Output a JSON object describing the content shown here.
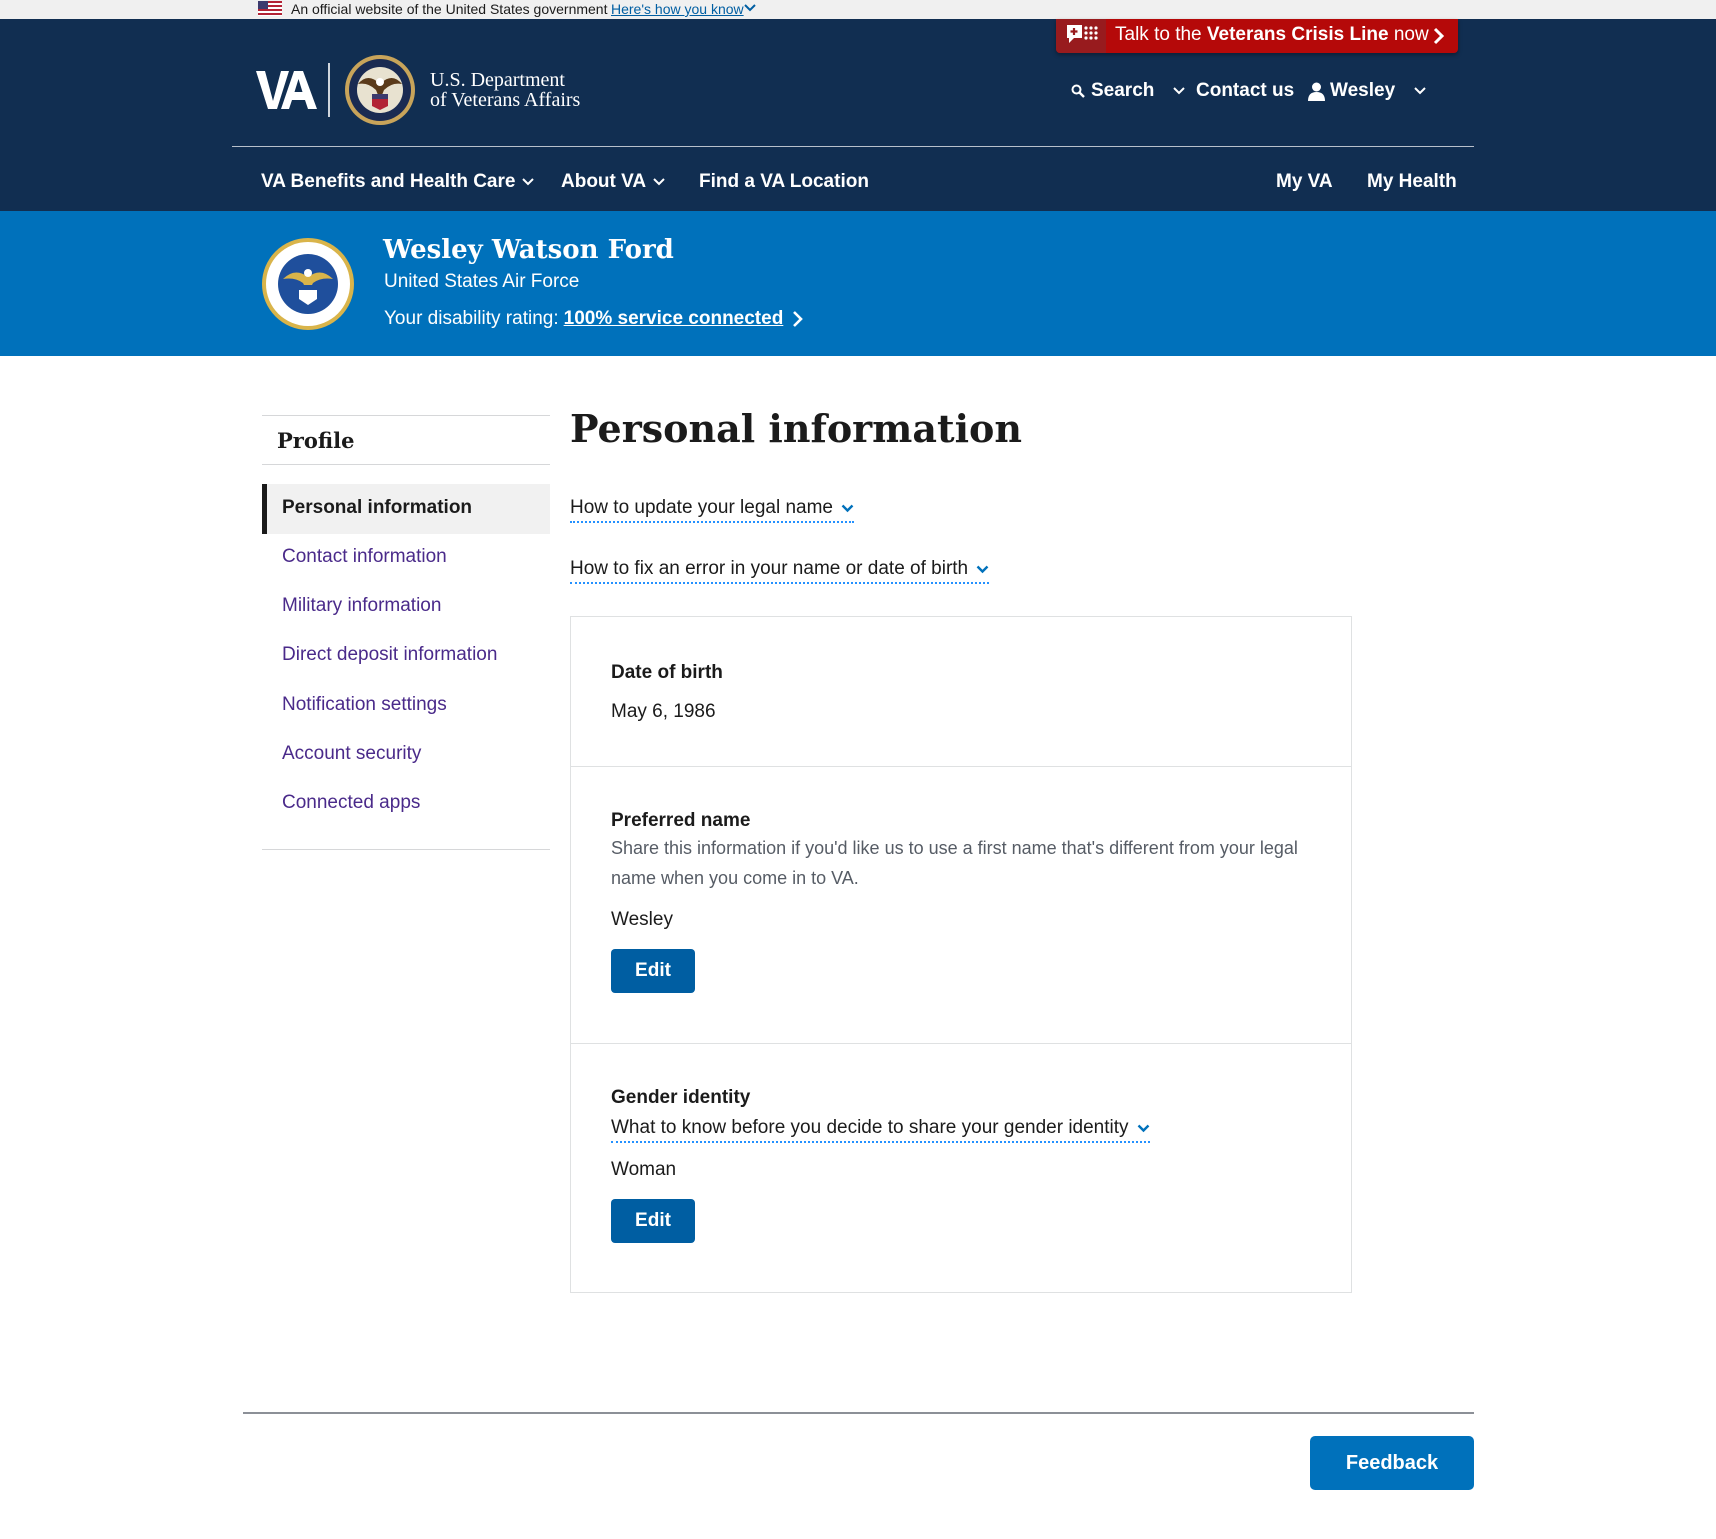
{
  "gov_banner": {
    "text": "An official website of the United States government",
    "link": "Here's how you know"
  },
  "crisis_line": {
    "prefix": "Talk to the ",
    "bold": "Veterans Crisis Line",
    "suffix": " now"
  },
  "header": {
    "dept_line1": "U.S. Department",
    "dept_line2": "of Veterans Affairs",
    "logo_text": "VA",
    "search_label": "Search",
    "contact_label": "Contact us",
    "user_label": "Wesley"
  },
  "nav": {
    "benefits": "VA Benefits and Health Care",
    "about": "About VA",
    "find": "Find a VA Location",
    "my_va": "My VA",
    "my_health": "My Health"
  },
  "hub": {
    "name": "Wesley Watson Ford",
    "branch": "United States Air Force",
    "rating_prefix": "Your disability rating:",
    "rating_link": "100% service connected"
  },
  "sidebar": {
    "title": "Profile",
    "items": [
      {
        "label": "Personal information",
        "active": true
      },
      {
        "label": "Contact information"
      },
      {
        "label": "Military information"
      },
      {
        "label": "Direct deposit information"
      },
      {
        "label": "Notification settings"
      },
      {
        "label": "Account security"
      },
      {
        "label": "Connected apps"
      }
    ]
  },
  "main": {
    "title": "Personal information",
    "disclosure_legal_name": "How to update your legal name",
    "disclosure_fix_error": "How to fix an error in your name or date of birth",
    "dob": {
      "label": "Date of birth",
      "value": "May 6, 1986"
    },
    "preferred_name": {
      "label": "Preferred name",
      "description": "Share this information if you'd like us to use a first name that's different from your legal name when you come in to VA.",
      "value": "Wesley",
      "edit_label": "Edit"
    },
    "gender_identity": {
      "label": "Gender identity",
      "disclosure": "What to know before you decide to share your gender identity",
      "value": "Woman",
      "edit_label": "Edit"
    }
  },
  "footer": {
    "feedback_label": "Feedback"
  },
  "colors": {
    "header_bg": "#112e51",
    "hub_bg": "#0071bb",
    "crisis_red": "#b50909",
    "button_blue": "#005ea2",
    "link_purple": "#4a2a8a"
  },
  "icons": {
    "flag": "us-flag-icon",
    "crisis": "crisis-line-icon",
    "search": "magnifier-icon",
    "user": "person-icon",
    "chevron": "chevron-down-icon",
    "seal": "air-force-seal-icon"
  }
}
